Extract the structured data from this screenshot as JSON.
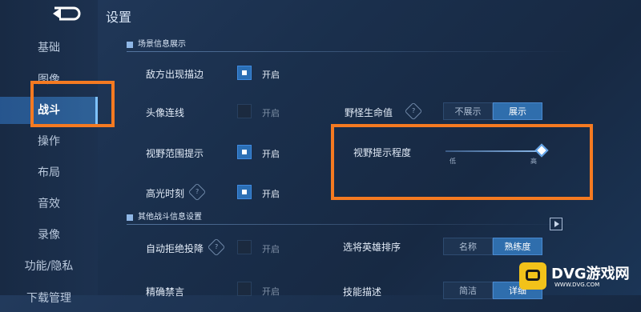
{
  "page_title": "设置",
  "sidebar": {
    "items": [
      {
        "label": "基础"
      },
      {
        "label": "图像"
      },
      {
        "label": "战斗"
      },
      {
        "label": "操作"
      },
      {
        "label": "布局"
      },
      {
        "label": "音效"
      },
      {
        "label": "录像"
      },
      {
        "label": "功能/隐私"
      },
      {
        "label": "下载管理"
      }
    ],
    "active_index": 2
  },
  "sections": {
    "scene": {
      "title": "场景信息展示"
    },
    "other": {
      "title": "其他战斗信息设置"
    }
  },
  "settings": {
    "enemy_outline": {
      "label": "敌方出现描边",
      "value": "开启",
      "checked": true
    },
    "avatar_line": {
      "label": "头像连线",
      "value": "开启",
      "checked": false
    },
    "vision_range": {
      "label": "视野范围提示",
      "value": "开启",
      "checked": true
    },
    "highlight": {
      "label": "高光时刻",
      "value": "开启",
      "checked": true
    },
    "auto_reject": {
      "label": "自动拒绝投降",
      "value": "开启",
      "checked": false
    },
    "partial_row": {
      "label": "精确禁言",
      "value": "开启",
      "checked": false
    },
    "monster_hp": {
      "label": "野怪生命值",
      "options": [
        "不展示",
        "展示"
      ],
      "selected": "展示"
    },
    "vision_hint_level": {
      "label": "视野提示程度",
      "low": "低",
      "high": "高",
      "level": 1.0
    },
    "hero_sort": {
      "label": "选将英雄排序",
      "options": [
        "名称",
        "熟练度"
      ],
      "selected": "熟练度"
    },
    "skill_row": {
      "label": "技能描述",
      "options": [
        "简洁",
        "详细"
      ],
      "selected": "详细"
    }
  },
  "watermark": {
    "brand": "DVG游戏网",
    "url": "WWW.DVG.COM"
  },
  "colors": {
    "accent": "#2f6ead",
    "highlight_box": "#f57a21"
  }
}
